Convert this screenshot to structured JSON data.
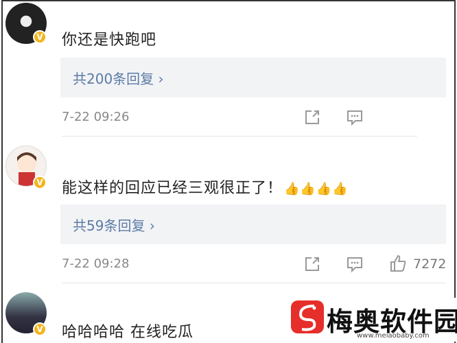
{
  "comments": [
    {
      "text": "你还是快跑吧",
      "replies_label": "共200条回复",
      "chevron": "›",
      "timestamp": "7-22 09:26",
      "badge": "V",
      "likes": ""
    },
    {
      "text": "能这样的回应已经三观很正了！",
      "replies_label": "共59条回复",
      "chevron": "›",
      "timestamp": "7-22 09:28",
      "badge": "V",
      "likes": "7272",
      "emoji": "👍👍👍👍"
    },
    {
      "text": "哈哈哈哈 在线吃瓜",
      "badge": "V"
    }
  ],
  "watermark": {
    "name": "梅奥软件园",
    "url": "www.meiaobaby.com"
  },
  "colors": {
    "link": "#5b7ba6",
    "reply_bg": "#f2f3f5",
    "badge": "#f3b51d",
    "logo": "#e62e2a"
  }
}
